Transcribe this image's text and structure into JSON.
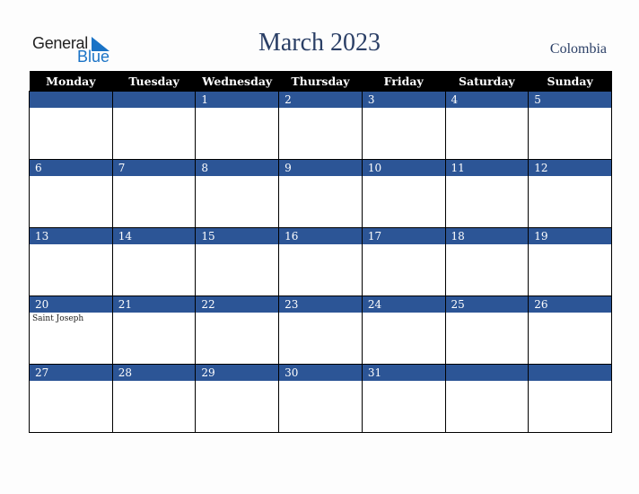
{
  "logo": {
    "word1": "General",
    "word2": "Blue"
  },
  "title": "March 2023",
  "country": "Colombia",
  "colors": {
    "header_bg": "#000000",
    "date_strip": "#2c5596",
    "title": "#2b3f66"
  },
  "weekdays": [
    "Monday",
    "Tuesday",
    "Wednesday",
    "Thursday",
    "Friday",
    "Saturday",
    "Sunday"
  ],
  "weeks": [
    [
      {
        "d": ""
      },
      {
        "d": ""
      },
      {
        "d": "1"
      },
      {
        "d": "2"
      },
      {
        "d": "3"
      },
      {
        "d": "4"
      },
      {
        "d": "5"
      }
    ],
    [
      {
        "d": "6"
      },
      {
        "d": "7"
      },
      {
        "d": "8"
      },
      {
        "d": "9"
      },
      {
        "d": "10"
      },
      {
        "d": "11"
      },
      {
        "d": "12"
      }
    ],
    [
      {
        "d": "13"
      },
      {
        "d": "14"
      },
      {
        "d": "15"
      },
      {
        "d": "16"
      },
      {
        "d": "17"
      },
      {
        "d": "18"
      },
      {
        "d": "19"
      }
    ],
    [
      {
        "d": "20",
        "e": "Saint Joseph"
      },
      {
        "d": "21"
      },
      {
        "d": "22"
      },
      {
        "d": "23"
      },
      {
        "d": "24"
      },
      {
        "d": "25"
      },
      {
        "d": "26"
      }
    ],
    [
      {
        "d": "27"
      },
      {
        "d": "28"
      },
      {
        "d": "29"
      },
      {
        "d": "30"
      },
      {
        "d": "31"
      },
      {
        "d": ""
      },
      {
        "d": ""
      }
    ]
  ]
}
